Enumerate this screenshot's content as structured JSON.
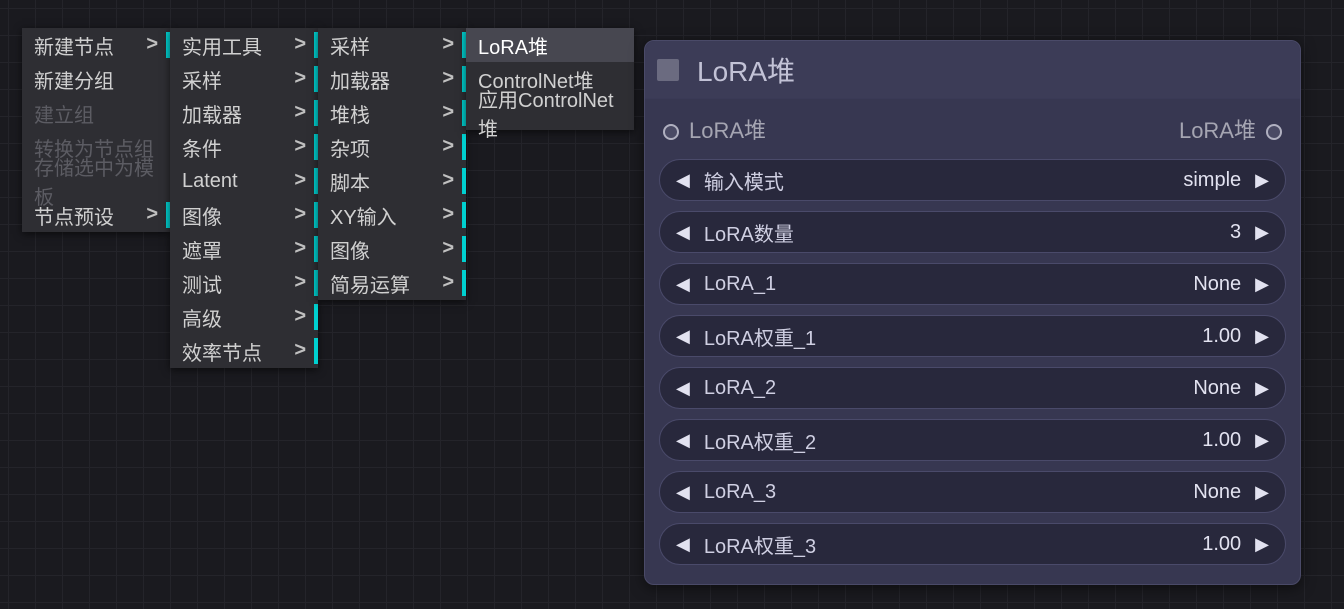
{
  "menus": {
    "col1": {
      "items": [
        {
          "label": "新建节点",
          "arrow": true,
          "cyan": true,
          "disabled": false
        },
        {
          "label": "新建分组",
          "arrow": false,
          "cyan": false,
          "disabled": false
        },
        {
          "label": "建立组",
          "arrow": false,
          "cyan": false,
          "disabled": true
        },
        {
          "label": "转换为节点组",
          "arrow": false,
          "cyan": false,
          "disabled": true
        },
        {
          "label": "存储选中为模板",
          "arrow": false,
          "cyan": false,
          "disabled": true
        },
        {
          "label": "节点预设",
          "arrow": true,
          "cyan": true,
          "disabled": false
        }
      ]
    },
    "col2": {
      "items": [
        {
          "label": "实用工具",
          "arrow": true,
          "cyan": true
        },
        {
          "label": "采样",
          "arrow": true,
          "cyan": true
        },
        {
          "label": "加载器",
          "arrow": true,
          "cyan": true
        },
        {
          "label": "条件",
          "arrow": true,
          "cyan": true
        },
        {
          "label": "Latent",
          "arrow": true,
          "cyan": true
        },
        {
          "label": "图像",
          "arrow": true,
          "cyan": true
        },
        {
          "label": "遮罩",
          "arrow": true,
          "cyan": true
        },
        {
          "label": "测试",
          "arrow": true,
          "cyan": true
        },
        {
          "label": "高级",
          "arrow": true,
          "cyan": true
        },
        {
          "label": "效率节点",
          "arrow": true,
          "cyan": true
        }
      ]
    },
    "col3": {
      "items": [
        {
          "label": "采样",
          "arrow": true,
          "cyan": true
        },
        {
          "label": "加载器",
          "arrow": true,
          "cyan": true
        },
        {
          "label": "堆栈",
          "arrow": true,
          "cyan": true
        },
        {
          "label": "杂项",
          "arrow": true,
          "cyan": true
        },
        {
          "label": "脚本",
          "arrow": true,
          "cyan": true
        },
        {
          "label": "XY输入",
          "arrow": true,
          "cyan": true
        },
        {
          "label": "图像",
          "arrow": true,
          "cyan": true
        },
        {
          "label": "简易运算",
          "arrow": true,
          "cyan": true
        }
      ]
    },
    "col4": {
      "items": [
        {
          "label": "LoRA堆",
          "hovered": true
        },
        {
          "label": "ControlNet堆"
        },
        {
          "label": "应用ControlNet堆"
        }
      ]
    }
  },
  "node": {
    "title": "LoRA堆",
    "input_label": "LoRA堆",
    "output_label": "LoRA堆",
    "widgets": [
      {
        "label": "输入模式",
        "value": "simple"
      },
      {
        "label": "LoRA数量",
        "value": "3"
      },
      {
        "label": "LoRA_1",
        "value": "None"
      },
      {
        "label": "LoRA权重_1",
        "value": "1.00"
      },
      {
        "label": "LoRA_2",
        "value": "None"
      },
      {
        "label": "LoRA权重_2",
        "value": "1.00"
      },
      {
        "label": "LoRA_3",
        "value": "None"
      },
      {
        "label": "LoRA权重_3",
        "value": "1.00"
      }
    ]
  }
}
